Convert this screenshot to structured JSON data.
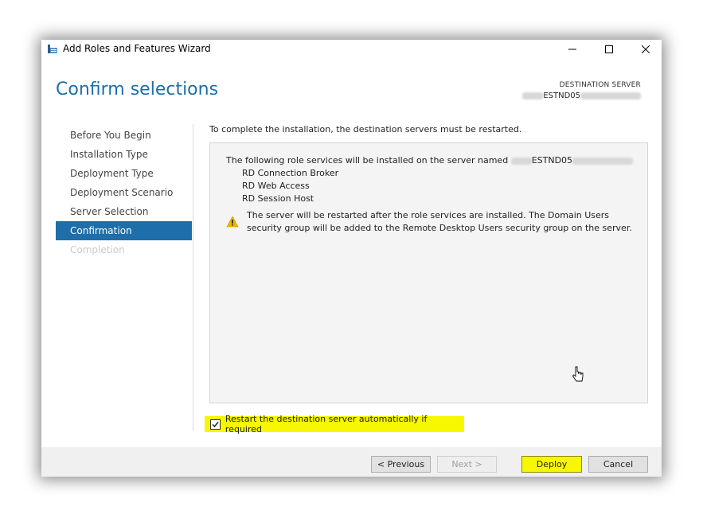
{
  "window": {
    "title": "Add Roles and Features Wizard",
    "controls": {
      "minimize": "minimize",
      "maximize": "maximize",
      "close": "close"
    }
  },
  "header": {
    "page_title": "Confirm selections",
    "destination_label": "DESTINATION SERVER",
    "destination_name_visible": "ESTND05"
  },
  "nav": {
    "items": [
      {
        "label": "Before You Begin",
        "state": "normal"
      },
      {
        "label": "Installation Type",
        "state": "normal"
      },
      {
        "label": "Deployment Type",
        "state": "normal"
      },
      {
        "label": "Deployment Scenario",
        "state": "normal"
      },
      {
        "label": "Server Selection",
        "state": "normal"
      },
      {
        "label": "Confirmation",
        "state": "active"
      },
      {
        "label": "Completion",
        "state": "disabled"
      }
    ]
  },
  "main": {
    "intro": "To complete the installation, the destination servers must be restarted.",
    "info_prefix": "The following role services will be installed on the server named",
    "server_name_visible": "ESTND05",
    "services": [
      "RD Connection Broker",
      "RD Web Access",
      "RD Session Host"
    ],
    "warning_icon": "warning-icon",
    "warning_text": "The server will be restarted after the role services are installed. The Domain Users security group will be added to the Remote Desktop Users security group on the server."
  },
  "restart_option": {
    "label": "Restart the destination server automatically if required",
    "checked": true
  },
  "buttons": {
    "previous": "< Previous",
    "next": "Next >",
    "deploy": "Deploy",
    "cancel": "Cancel"
  },
  "colors": {
    "accent": "#1e6fa9",
    "highlight": "#f7f700",
    "warning": "#f2b400"
  }
}
